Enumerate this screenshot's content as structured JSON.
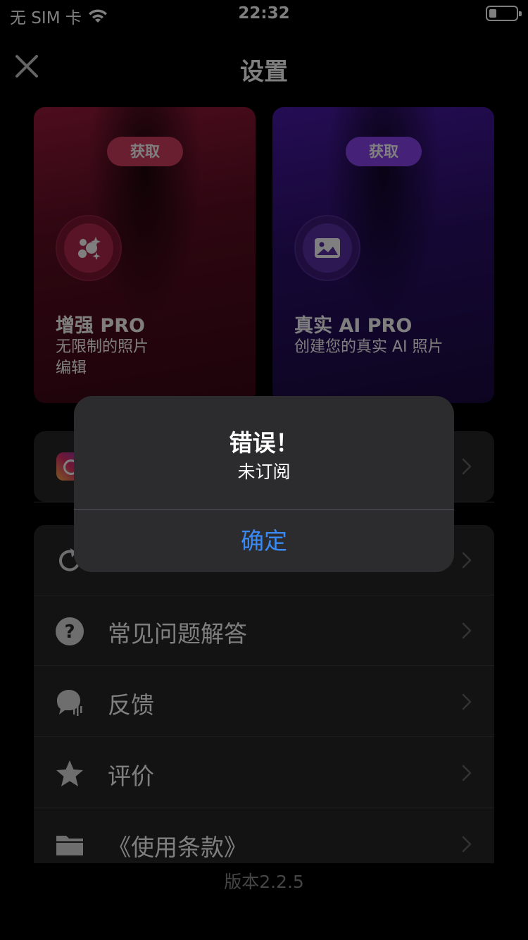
{
  "status_bar": {
    "carrier": "无 SIM 卡",
    "time": "22:32"
  },
  "nav": {
    "title": "设置"
  },
  "cards": [
    {
      "button": "获取",
      "title": "增强 PRO",
      "subtitle": "无限制的照片\n编辑",
      "icon": "sparkle-bubbles-icon",
      "accent": "#d43e62"
    },
    {
      "button": "获取",
      "title": "真实 AI PRO",
      "subtitle": "创建您的真实 AI 照片",
      "icon": "image-icon",
      "accent": "#8a45ee"
    }
  ],
  "menu": {
    "items": [
      {
        "label": "常见问题解答",
        "icon": "question-icon"
      },
      {
        "label": "反馈",
        "icon": "feedback-icon"
      },
      {
        "label": "评价",
        "icon": "star-icon"
      },
      {
        "label": "《使用条款》",
        "icon": "folder-icon"
      }
    ]
  },
  "footer": {
    "version": "版本2.2.5"
  },
  "alert": {
    "title": "错误！",
    "message": "未订阅",
    "confirm": "确定",
    "confirm_color": "#3a8af5"
  }
}
